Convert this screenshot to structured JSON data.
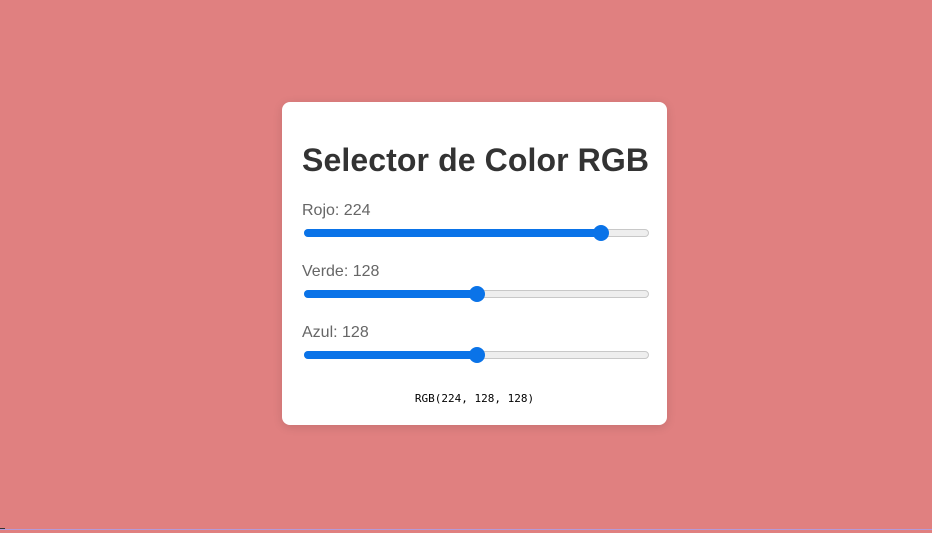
{
  "title": "Selector de Color RGB",
  "sliders": [
    {
      "id": "red",
      "label_prefix": "Rojo: ",
      "value": 224,
      "min": 0,
      "max": 255
    },
    {
      "id": "green",
      "label_prefix": "Verde: ",
      "value": 128,
      "min": 0,
      "max": 255
    },
    {
      "id": "blue",
      "label_prefix": "Azul: ",
      "value": 128,
      "min": 0,
      "max": 255
    }
  ],
  "output_text": "RGB(224, 128, 128)",
  "colors": {
    "background": "#e08080",
    "accent": "#0a73e8",
    "card": "#ffffff"
  }
}
